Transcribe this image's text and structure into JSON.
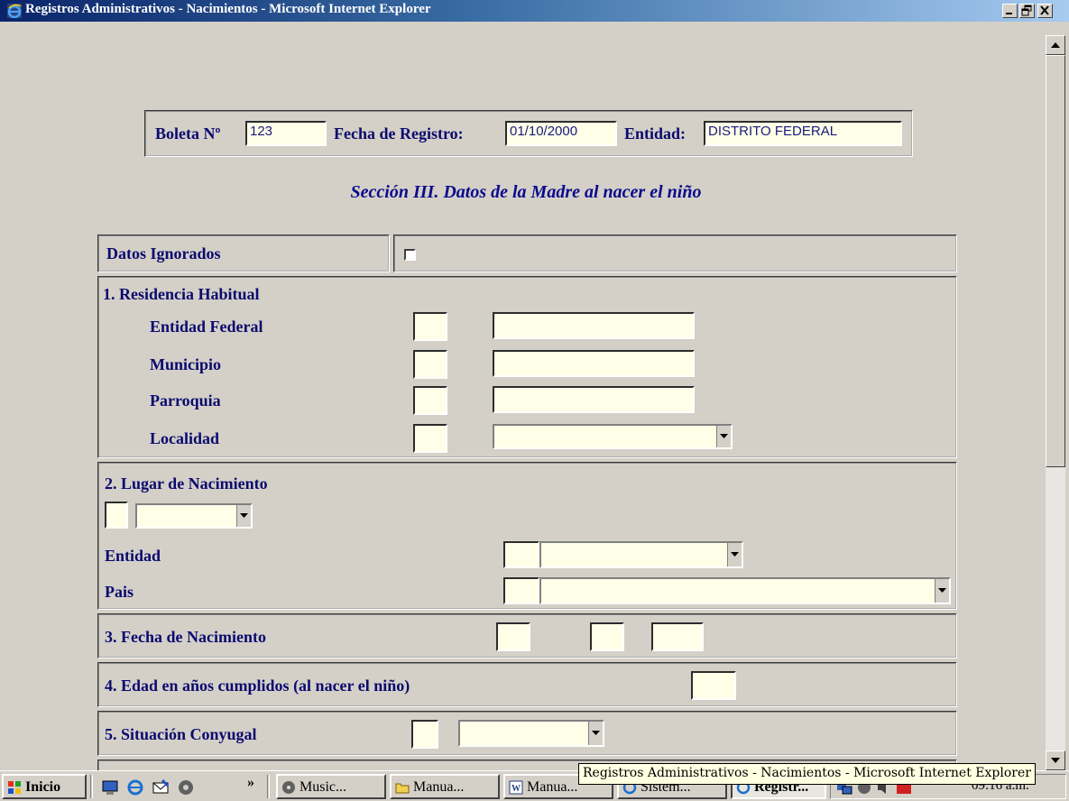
{
  "window": {
    "title": "Registros Administrativos - Nacimientos - Microsoft Internet Explorer"
  },
  "header": {
    "boleta_label": "Boleta Nº",
    "boleta_value": "123",
    "fecha_label": "Fecha de Registro:",
    "fecha_value": "01/10/2000",
    "entidad_label": "Entidad:",
    "entidad_value": "DISTRITO FEDERAL"
  },
  "section_title": "Sección III. Datos de la Madre al nacer el niño",
  "datos_ignorados_label": "Datos Ignorados",
  "residencia": {
    "title": "1. Residencia Habitual",
    "entidad_federal": "Entidad Federal",
    "municipio": "Municipio",
    "parroquia": "Parroquia",
    "localidad": "Localidad"
  },
  "lugar_nacimiento": {
    "title": "2. Lugar de Nacimiento",
    "entidad": "Entidad",
    "pais": "Pais"
  },
  "fecha_nacimiento": {
    "title": "3. Fecha de Nacimiento"
  },
  "edad": {
    "title": "4. Edad en años cumplidos (al nacer el niño)"
  },
  "situacion": {
    "title": "5. Situación Conyugal"
  },
  "taskbar": {
    "start": "Inicio",
    "chevron": "»",
    "buttons": [
      "Music...",
      "Manua...",
      "Manua...",
      "Sistem...",
      "Registr..."
    ],
    "clock": "09:16 a.m."
  },
  "tooltip": "Registros Administrativos - Nacimientos - Microsoft Internet Explorer"
}
